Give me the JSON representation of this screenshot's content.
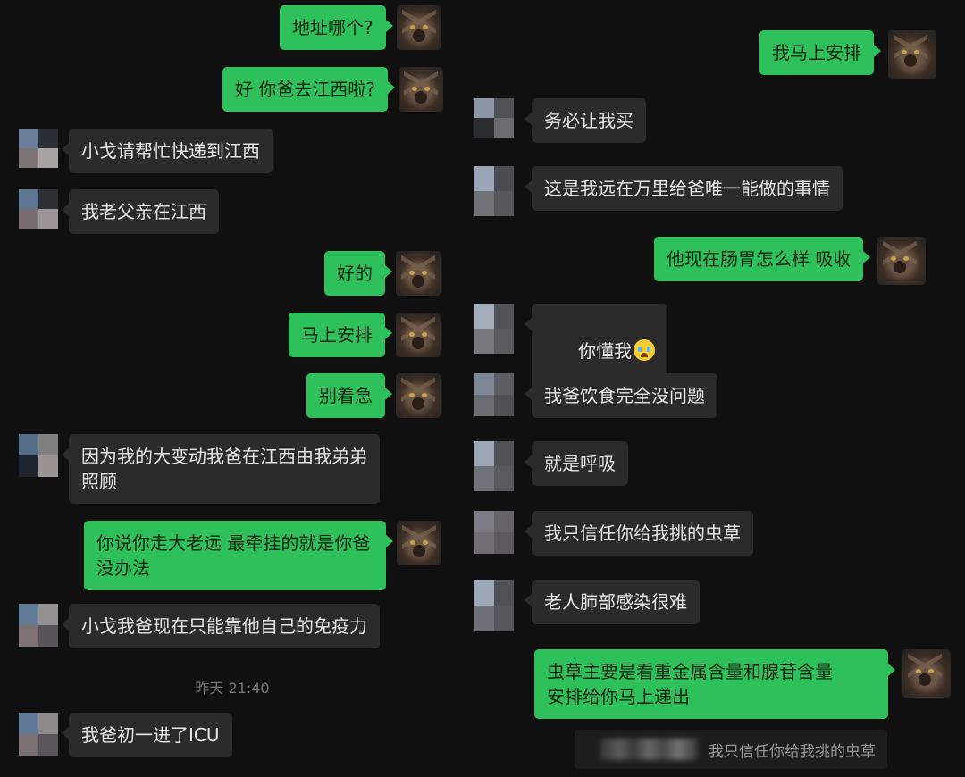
{
  "left": {
    "messages": [
      {
        "dir": "out",
        "text": "地址哪个?"
      },
      {
        "dir": "out",
        "text": "好 你爸去江西啦?"
      },
      {
        "dir": "in",
        "text": "小戈请帮忙快递到江西"
      },
      {
        "dir": "in",
        "text": "我老父亲在江西"
      },
      {
        "dir": "out",
        "text": "好的"
      },
      {
        "dir": "out",
        "text": "马上安排"
      },
      {
        "dir": "out",
        "text": "别着急"
      },
      {
        "dir": "in",
        "text": "因为我的大变动我爸在江西由我弟弟\n照顾"
      },
      {
        "dir": "out",
        "text": "你说你走大老远 最牵挂的就是你爸\n没办法"
      },
      {
        "dir": "in",
        "text": "小戈我爸现在只能靠他自己的免疫力"
      },
      {
        "dir": "in",
        "text": "我爸初一进了ICU"
      }
    ],
    "timestamp": "昨天 21:40"
  },
  "right": {
    "messages": [
      {
        "dir": "out",
        "text": "我马上安排"
      },
      {
        "dir": "in",
        "text": "务必让我买"
      },
      {
        "dir": "in",
        "text": "这是我远在万里给爸唯一能做的事情"
      },
      {
        "dir": "out",
        "text": "他现在肠胃怎么样 吸收"
      },
      {
        "dir": "in",
        "text": "你懂我",
        "emoji": "crying-face"
      },
      {
        "dir": "in",
        "text": "我爸饮食完全没问题"
      },
      {
        "dir": "in",
        "text": "就是呼吸"
      },
      {
        "dir": "in",
        "text": "我只信任你给我挑的虫草"
      },
      {
        "dir": "in",
        "text": "老人肺部感染很难"
      },
      {
        "dir": "out",
        "text": "虫草主要是看重金属含量和腺苷含量\n安排给你马上递出"
      }
    ],
    "quote": "我只信任你给我挑的虫草"
  },
  "colors": {
    "background": "#101010",
    "incoming_bubble": "#2b2b2b",
    "outgoing_bubble": "#2ec05a"
  }
}
